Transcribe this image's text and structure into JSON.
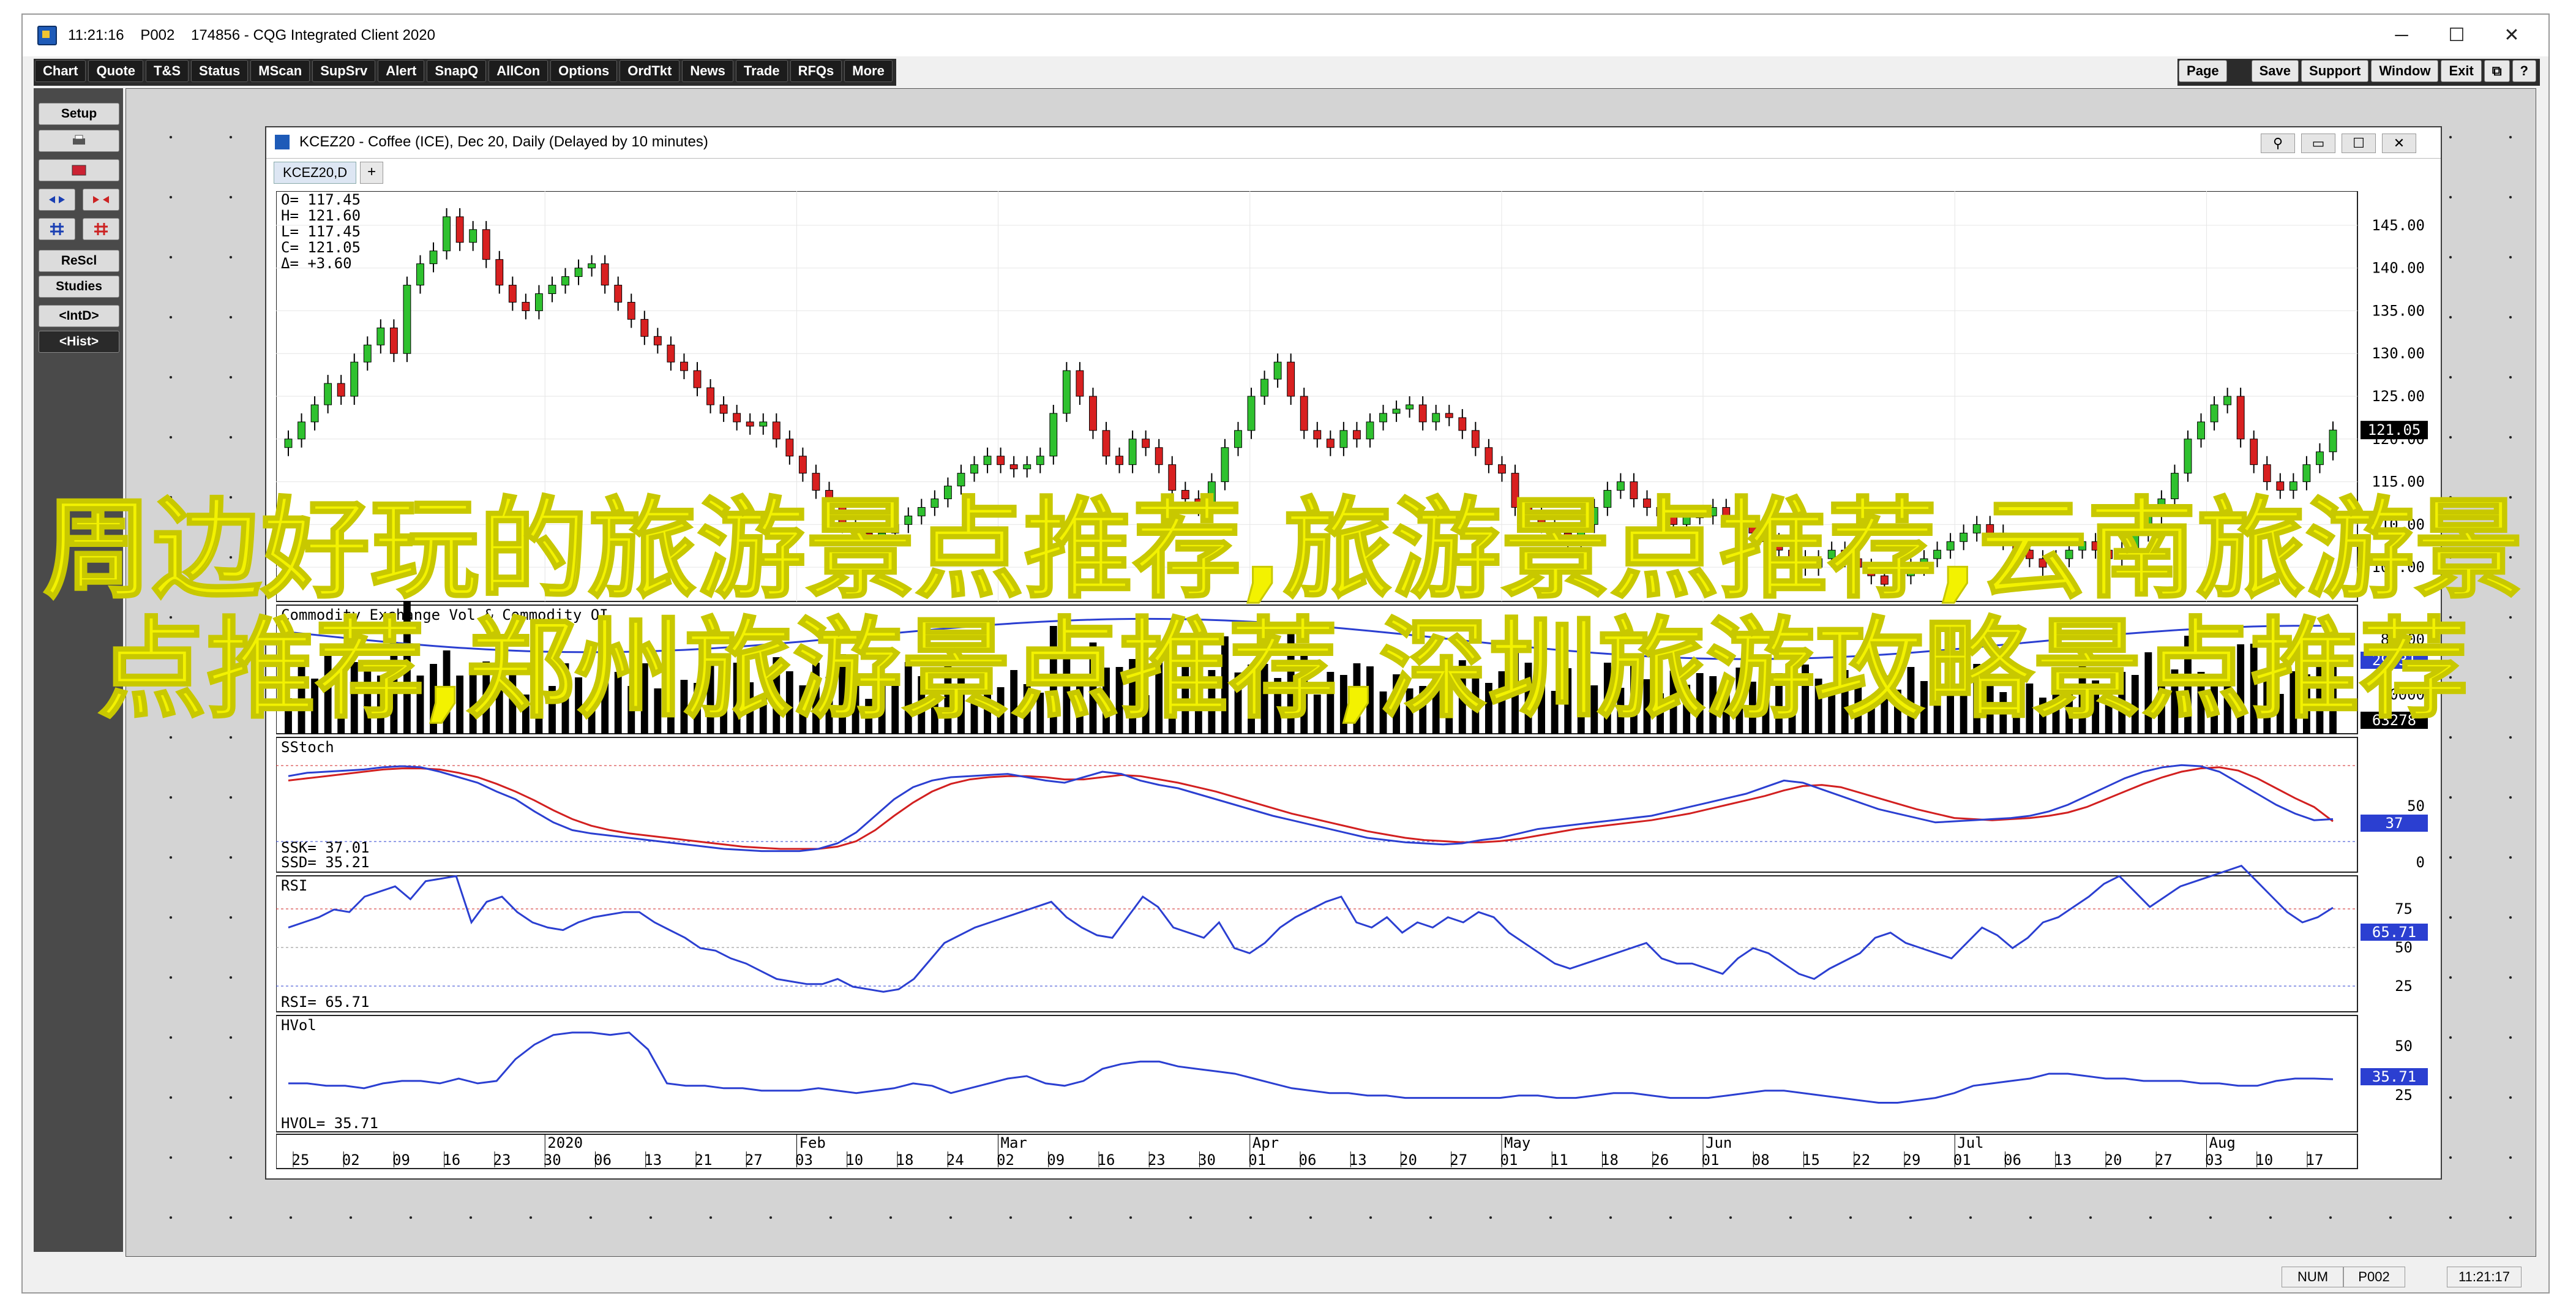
{
  "window": {
    "title": "11:21:16    P002    174856 - CQG Integrated Client 2020",
    "minimize": "─",
    "maximize": "☐",
    "close": "✕"
  },
  "menu": [
    "Chart",
    "Quote",
    "T&S",
    "Status",
    "MScan",
    "SupSrv",
    "Alert",
    "SnapQ",
    "AllCon",
    "Options",
    "OrdTkt",
    "News",
    "Trade",
    "RFQs",
    "More"
  ],
  "right_menu": [
    "Page",
    "Save",
    "Support",
    "Window",
    "Exit"
  ],
  "left_panel": {
    "setup": "Setup",
    "resclm": "ReScl",
    "studies": "Studies",
    "intd": "<IntD>",
    "hist": "<Hist>"
  },
  "chart_window": {
    "title": "KCEZ20 - Coffee (ICE), Dec 20, Daily (Delayed by 10 minutes)",
    "tab": "KCEZ20,D",
    "tab_add": "+"
  },
  "status": {
    "num": "NUM",
    "page": "P002",
    "time": "11:21:17"
  },
  "overlay_text": "周边好玩的旅游景点推荐,旅游景点推荐,云南旅游景点推荐,郑州旅游景点推荐,深圳旅游攻略景点推荐",
  "chart_data": [
    {
      "type": "candlestick",
      "title": "",
      "ohlc_readout": {
        "O": "117.45",
        "H": "121.60",
        "L": "117.45",
        "C": "121.05",
        "Δ": "+3.60"
      },
      "last_price_tag": "121.05",
      "ylim": [
        101,
        149
      ],
      "y_ticks": [
        "145.00",
        "140.00",
        "135.00",
        "130.00",
        "125.00",
        "120.00",
        "115.00",
        "110.00",
        "105.00"
      ],
      "close": [
        120.0,
        122.0,
        124.0,
        126.5,
        125.0,
        129.0,
        131.0,
        133.0,
        130.0,
        138.0,
        140.5,
        142.0,
        146.0,
        143.0,
        144.5,
        141.0,
        138.0,
        136.0,
        135.0,
        137.0,
        138.0,
        139.0,
        140.0,
        140.5,
        138.0,
        136.0,
        134.0,
        132.0,
        131.0,
        129.0,
        128.0,
        126.0,
        124.0,
        123.0,
        122.0,
        121.5,
        122.0,
        120.0,
        118.0,
        116.0,
        114.0,
        112.0,
        110.0,
        109.0,
        108.5,
        109.0,
        110.0,
        111.0,
        112.0,
        113.0,
        114.5,
        116.0,
        117.0,
        118.0,
        117.0,
        116.5,
        117.0,
        118.0,
        123.0,
        128.0,
        125.0,
        121.0,
        118.0,
        117.0,
        120.0,
        119.0,
        117.0,
        114.0,
        113.0,
        112.0,
        115.0,
        119.0,
        121.0,
        125.0,
        127.0,
        129.0,
        125.0,
        121.0,
        120.0,
        119.0,
        121.0,
        120.0,
        122.0,
        123.0,
        123.5,
        124.0,
        122.0,
        123.0,
        122.5,
        121.0,
        119.0,
        117.0,
        116.0,
        112.0,
        111.0,
        110.0,
        109.0,
        108.0,
        110.0,
        112.0,
        114.0,
        115.0,
        113.0,
        112.0,
        111.0,
        110.0,
        111.0,
        111.0,
        112.0,
        111.0,
        110.0,
        109.0,
        108.0,
        107.0,
        106.0,
        105.0,
        106.0,
        107.0,
        106.0,
        105.0,
        104.0,
        103.0,
        104.0,
        105.0,
        106.0,
        107.0,
        108.0,
        109.0,
        110.0,
        109.0,
        108.0,
        107.0,
        106.0,
        105.0,
        106.0,
        107.0,
        108.0,
        107.0,
        106.0,
        107.0,
        109.0,
        111.0,
        113.0,
        116.0,
        120.0,
        122.0,
        124.0,
        125.0,
        120.0,
        117.0,
        115.0,
        114.0,
        115.0,
        117.0,
        118.5,
        121.05
      ]
    },
    {
      "type": "bar",
      "title": "Commodity Exchange Vol & Commodity OI",
      "values_tag": "29731",
      "oi_tag": "63278",
      "y_ticks": [
        "80000",
        "40000"
      ]
    },
    {
      "type": "line",
      "title": "SStoch",
      "readouts": {
        "SSK": "37.01",
        "SSD": "35.21"
      },
      "tags": {
        "ssk": "37"
      },
      "ylim": [
        0,
        100
      ],
      "y_ticks": [
        "50",
        "0"
      ],
      "series": [
        {
          "name": "SSK",
          "color": "#2b3fd1",
          "values": [
            76,
            79,
            80,
            81,
            82,
            84,
            85,
            84,
            80,
            75,
            70,
            62,
            55,
            44,
            34,
            27,
            24,
            22,
            20,
            18,
            16,
            14,
            12,
            10,
            9,
            8,
            8,
            8,
            10,
            15,
            25,
            40,
            55,
            66,
            72,
            75,
            76,
            77,
            78,
            75,
            72,
            70,
            75,
            80,
            78,
            72,
            68,
            65,
            60,
            55,
            50,
            45,
            40,
            36,
            32,
            28,
            24,
            20,
            18,
            16,
            15,
            14,
            15,
            18,
            20,
            24,
            28,
            30,
            32,
            34,
            36,
            38,
            40,
            44,
            48,
            52,
            56,
            60,
            66,
            72,
            70,
            64,
            58,
            52,
            46,
            42,
            38,
            34,
            35,
            36,
            37,
            38,
            40,
            44,
            50,
            58,
            66,
            74,
            80,
            84,
            86,
            85,
            80,
            70,
            60,
            50,
            42,
            36,
            37
          ]
        },
        {
          "name": "SSD",
          "color": "#d22020",
          "values": [
            72,
            74,
            76,
            78,
            80,
            82,
            83,
            83,
            82,
            79,
            75,
            69,
            62,
            54,
            45,
            37,
            31,
            27,
            24,
            22,
            20,
            18,
            16,
            14,
            12,
            11,
            10,
            10,
            10,
            12,
            17,
            27,
            40,
            52,
            62,
            69,
            73,
            75,
            76,
            76,
            75,
            73,
            73,
            75,
            77,
            76,
            73,
            70,
            66,
            62,
            57,
            52,
            47,
            42,
            38,
            34,
            30,
            26,
            23,
            20,
            18,
            17,
            16,
            16,
            17,
            19,
            22,
            25,
            28,
            30,
            32,
            34,
            36,
            39,
            42,
            46,
            50,
            54,
            58,
            63,
            67,
            68,
            66,
            61,
            56,
            51,
            46,
            42,
            38,
            37,
            36,
            37,
            38,
            40,
            43,
            48,
            55,
            62,
            69,
            75,
            80,
            83,
            84,
            81,
            74,
            65,
            56,
            48,
            35
          ]
        }
      ]
    },
    {
      "type": "line",
      "title": "RSI",
      "readouts": {
        "RSI": "65.71"
      },
      "tag": "65.71",
      "ylim": [
        20,
        80
      ],
      "y_ticks": [
        "75",
        "50",
        "25"
      ],
      "series": [
        {
          "name": "RSI",
          "color": "#2b3fd1",
          "values": [
            58,
            60,
            62,
            65,
            64,
            70,
            72,
            74,
            69,
            76,
            77,
            78,
            60,
            68,
            70,
            64,
            60,
            58,
            57,
            60,
            62,
            63,
            64,
            64,
            60,
            57,
            54,
            50,
            49,
            46,
            44,
            41,
            38,
            37,
            36,
            36,
            38,
            35,
            34,
            33,
            34,
            38,
            45,
            52,
            55,
            58,
            60,
            62,
            64,
            66,
            68,
            62,
            58,
            55,
            54,
            62,
            70,
            66,
            58,
            56,
            54,
            60,
            50,
            48,
            52,
            58,
            62,
            65,
            68,
            70,
            60,
            58,
            62,
            56,
            60,
            58,
            62,
            60,
            64,
            62,
            56,
            52,
            48,
            44,
            42,
            44,
            46,
            48,
            50,
            52,
            46,
            44,
            44,
            42,
            40,
            46,
            50,
            48,
            44,
            40,
            38,
            42,
            45,
            48,
            54,
            56,
            52,
            50,
            48,
            46,
            52,
            58,
            55,
            50,
            54,
            60,
            62,
            66,
            70,
            75,
            78,
            72,
            66,
            70,
            74,
            76,
            78,
            80,
            82,
            76,
            70,
            64,
            60,
            62,
            65.71
          ]
        }
      ]
    },
    {
      "type": "line",
      "title": "HVol",
      "readouts": {
        "HVOL": "35.71"
      },
      "tag": "35.71",
      "ylim": [
        15,
        58
      ],
      "y_ticks": [
        "50",
        "25"
      ],
      "series": [
        {
          "name": "HVOL",
          "color": "#2b3fd1",
          "values": [
            34,
            34,
            33,
            33,
            32,
            34,
            35,
            35,
            34,
            36,
            34,
            35,
            44,
            50,
            54,
            55,
            55,
            54,
            55,
            48,
            34,
            33,
            33,
            32,
            32,
            31,
            31,
            31,
            32,
            31,
            30,
            31,
            32,
            34,
            33,
            30,
            32,
            34,
            36,
            37,
            34,
            33,
            35,
            40,
            42,
            43,
            43,
            41,
            40,
            39,
            38,
            36,
            34,
            32,
            31,
            30,
            30,
            29,
            29,
            28,
            28,
            28,
            28,
            28,
            28,
            29,
            29,
            28,
            28,
            29,
            30,
            30,
            29,
            28,
            28,
            28,
            29,
            30,
            31,
            31,
            30,
            29,
            28,
            27,
            26,
            26,
            27,
            28,
            30,
            33,
            34,
            35,
            36,
            38,
            38,
            37,
            36,
            36,
            35,
            35,
            35,
            34,
            34,
            33,
            33,
            35,
            36,
            36,
            35.71
          ]
        }
      ]
    }
  ],
  "x_axis": {
    "months": [
      "2020",
      "Feb",
      "Mar",
      "Apr",
      "May",
      "Jun",
      "Jul",
      "Aug"
    ],
    "days": [
      "25",
      "02",
      "09",
      "16",
      "23",
      "30",
      "06",
      "13",
      "21",
      "27",
      "03",
      "10",
      "18",
      "24",
      "02",
      "09",
      "16",
      "23",
      "30",
      "01",
      "06",
      "13",
      "20",
      "27",
      "01",
      "11",
      "18",
      "26",
      "01",
      "08",
      "15",
      "22",
      "29",
      "01",
      "06",
      "13",
      "20",
      "27",
      "03",
      "10",
      "17"
    ]
  }
}
